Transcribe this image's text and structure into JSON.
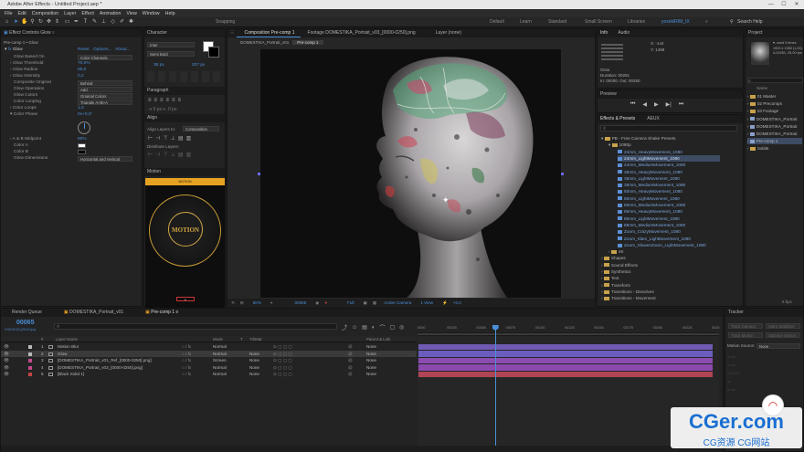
{
  "window": {
    "title": "Adobe After Effects - Untitled Project.aep *",
    "min": "—",
    "max": "☐",
    "close": "✕"
  },
  "menu": [
    "File",
    "Edit",
    "Composition",
    "Layer",
    "Effect",
    "Animation",
    "View",
    "Window",
    "Help"
  ],
  "toolbar": {
    "snapping": "Snapping",
    "workspaces": [
      "Default",
      "Learn",
      "Standard",
      "Small Screen",
      "Libraries",
      "yoseklRIM_IX"
    ],
    "search": "Search Help"
  },
  "effect_controls": {
    "tab": "Effect Controls Glow",
    "layer": "Pre-comp 1 • Glow",
    "effect_name": "Glow",
    "reset": "Reset",
    "options": "Options...",
    "about": "About...",
    "props": [
      {
        "label": "Glow Based On",
        "value": "Color Channels",
        "type": "dropdown"
      },
      {
        "label": "Glow Threshold",
        "value": "70,0%",
        "type": "value"
      },
      {
        "label": "Glow Radius",
        "value": "95,0",
        "type": "value"
      },
      {
        "label": "Glow Intensity",
        "value": "0,2",
        "type": "value"
      },
      {
        "label": "Composite Original",
        "value": "Behind",
        "type": "dropdown"
      },
      {
        "label": "Glow Operation",
        "value": "Add",
        "type": "dropdown"
      },
      {
        "label": "Glow Colors",
        "value": "Original Colors",
        "type": "dropdown"
      },
      {
        "label": "Color Looping",
        "value": "Triangle A>B>A",
        "type": "dropdown"
      },
      {
        "label": "Color Loops",
        "value": "1,0",
        "type": "value"
      },
      {
        "label": "Color Phase",
        "value": "0x+0,0°",
        "type": "value"
      }
    ],
    "midpoint_label": "A & B Midpoint",
    "midpoint_value": "50%",
    "color_a": "Color A",
    "color_b": "Color B",
    "dimensions_label": "Glow Dimensions",
    "dimensions_value": "Horizontal and Vertical"
  },
  "character": {
    "tab": "Character",
    "font": "Inter",
    "weight": "Semi Bold",
    "size": "38 px",
    "leading": "207 px",
    "paragraph_tab": "Paragraph",
    "align_tab": "Align",
    "align_to_label": "Align Layers to:",
    "align_to": "Composition",
    "distribute": "Distribute Layers:",
    "motion_tab": "Motion",
    "motion_title": "MOTION"
  },
  "viewer": {
    "tabs": [
      "Composition Pre-comp 1",
      "Footage DOMESTIKA_Portrait_v03_[0000-0250].png",
      "Layer (none)"
    ],
    "breadcrumb": [
      "DOMESTIKA_Portrait_v01",
      "Pre-comp 1"
    ],
    "zoom": "50%",
    "timecode": "00065",
    "resolution": "Full",
    "camera": "Active Camera",
    "views": "1 View",
    "exposure": "+0,0"
  },
  "info": {
    "tab": "Info",
    "audio_tab": "Audio",
    "x": "X: -144",
    "y": "Y: 1498",
    "layer": "Glow",
    "duration": "Duration: 00251",
    "inout": "In: 00000, Out: 00250"
  },
  "preview": {
    "tab": "Preview"
  },
  "effects_presets": {
    "tab": "Effects & Presets",
    "aeux_tab": "AEUX",
    "search_placeholder": "",
    "root": "PB - Free Camera Shake Presets",
    "folder": "1080p",
    "items": [
      "24mm_HeavyMovement_1080",
      "24mm_LightMovement_1080",
      "24mm_MediumMovement_1080",
      "35mm_HeavyMovement_1080",
      "35mm_LightMovement_1080",
      "35mm_MediumMovement_1080",
      "50mm_HeavyMovement_1080",
      "50mm_LightMovement_1080",
      "50mm_MediumMovement_1080",
      "85mm_HeavyMovement_1080",
      "85mm_LightMovement_1080",
      "85mm_MediumMovement_1080",
      "Zoom_CrazyMovement_1080",
      "Zoom_Slam_LightMovement_1080",
      "Zoom_SlowenZoom_LightMovement_1080"
    ],
    "folders2": [
      "4K",
      "Shapes",
      "Sound Effects",
      "Synthetics",
      "Text",
      "Transform",
      "Transitions - Dissolves",
      "Transitions - Movement"
    ]
  },
  "project": {
    "tab": "Project",
    "thumb_info": [
      "▾, used 5 times",
      "1920 x 1080 (1,00)",
      "Δ 00251, 25,00 fps"
    ],
    "col": "Name",
    "items": [
      {
        "name": "01 Master",
        "type": "folder"
      },
      {
        "name": "02 Precomps",
        "type": "folder"
      },
      {
        "name": "03 Footage",
        "type": "folder"
      },
      {
        "name": "DOMESTIKA_Portrait",
        "type": "comp"
      },
      {
        "name": "DOMESTIKA_Portrait",
        "type": "comp"
      },
      {
        "name": "DOMESTIKA_Portrait",
        "type": "comp"
      },
      {
        "name": "Pre-comp 1",
        "type": "comp"
      },
      {
        "name": "Solids",
        "type": "folder"
      }
    ],
    "bpc": "8 bpc"
  },
  "timeline": {
    "tabs": [
      "Render Queue",
      "DOMESTIKA_Portrait_v01",
      "Pre-comp 1"
    ],
    "timecode": "00065",
    "timecode_sub": "0:00:02:15 (25.00 fps)",
    "col_headers": {
      "num": "#",
      "name": "Layer Name",
      "mode": "Mode",
      "t": "T",
      "trkmat": "TrkMat",
      "parent": "Parent & Link"
    },
    "layers": [
      {
        "num": "1",
        "name": "Motion Blur",
        "mode": "Normal",
        "trkmat": "",
        "parent": "None",
        "color": "#b8b8b8"
      },
      {
        "num": "2",
        "name": "Glow",
        "mode": "Normal",
        "trkmat": "None",
        "parent": "None",
        "color": "#b8b8b8"
      },
      {
        "num": "3",
        "name": "[DOMESTIKA_Portrait_v01_Ref_[0000-0250].png]",
        "mode": "Screen",
        "trkmat": "None",
        "parent": "None",
        "color": "#c44a8a"
      },
      {
        "num": "4",
        "name": "[DOMESTIKA_Portrait_v03_[0000-0250].png]",
        "mode": "Normal",
        "trkmat": "None",
        "parent": "None",
        "color": "#c44a8a"
      },
      {
        "num": "5",
        "name": "[Black Solid 1]",
        "mode": "Normal",
        "trkmat": "None",
        "parent": "None",
        "color": "#c44444"
      }
    ],
    "ruler": [
      "0000",
      "00025",
      "00050",
      "00075",
      "00100",
      "00125",
      "00150",
      "00175",
      "00200",
      "00225",
      "0025"
    ],
    "bar_colors": [
      "#6f5bb3",
      "#6a5dbd",
      "#8b4bb0",
      "#8d4aae",
      "#b04555"
    ],
    "playhead_fraction": 0.26
  },
  "tracker": {
    "tab": "Tracker",
    "buttons": [
      "Track Camera",
      "Warp Stabilizer",
      "Track Motion",
      "Stabilize Motion"
    ],
    "motion_source": "Motion Source:",
    "motion_source_val": "None"
  },
  "watermark": {
    "main": "CGer.com",
    "sub": "CG资源  CG网站",
    "color": "#1a6fd1"
  }
}
